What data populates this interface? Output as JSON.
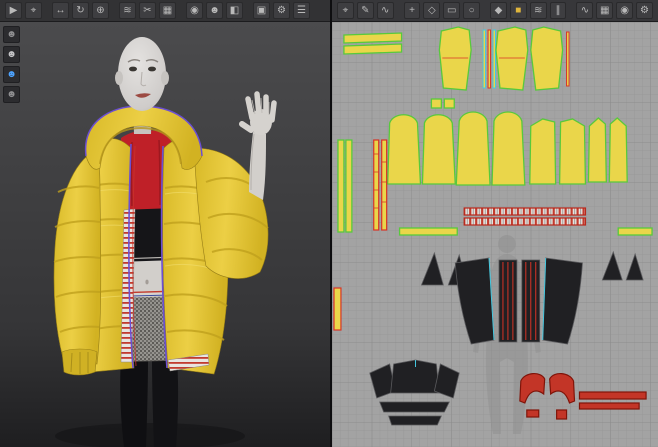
{
  "colors": {
    "toolbar_bg": "#323234",
    "toolbar_icon": "#b9b9b9",
    "accent_blue": "#4da3ff",
    "viewport3d_top": "#4b4b4d",
    "viewport3d_bottom": "#1e1e20",
    "jacket_yellow": "#e8c93a",
    "jacket_seam_shadow": "#bfa01d",
    "trim_purple": "#6b4fd2",
    "trim_red": "#c8352c",
    "crop_top_red": "#bf2028",
    "garment_black": "#151518",
    "skin": "#d2cfcb",
    "skirt_tweed_gray": "#96948f",
    "pattern_bg": "#a3a3a3",
    "grid_minor": "#989898",
    "grid_major": "#8c8c8c",
    "pattern_yellow": "#ead64a",
    "pattern_outline_green": "#58c93c",
    "pattern_black": "#202023",
    "pattern_red": "#c33527",
    "pattern_cyan": "#45c8e0",
    "ghost_silhouette": "#8f8f8f"
  },
  "left_panel": {
    "toolbar_icons": [
      {
        "name": "simulate",
        "glyph": "▶"
      },
      {
        "name": "select-tool",
        "glyph": "⌖"
      },
      {
        "name": "move-tool",
        "glyph": "↔",
        "gap": 1
      },
      {
        "name": "rotate-tool",
        "glyph": "↻"
      },
      {
        "name": "pin-tool",
        "glyph": "⊕"
      },
      {
        "name": "sewing-tool",
        "glyph": "≋",
        "gap": 1
      },
      {
        "name": "scissors-tool",
        "glyph": "✂"
      },
      {
        "name": "texture-view",
        "glyph": "▦"
      },
      {
        "name": "camera-view",
        "glyph": "◉",
        "gap": 1
      },
      {
        "name": "avatar-display",
        "glyph": "☻"
      },
      {
        "name": "cloth-display",
        "glyph": "◧"
      },
      {
        "name": "mesh-display",
        "glyph": "▣",
        "gap": 1
      },
      {
        "name": "render-settings",
        "glyph": "⚙"
      },
      {
        "name": "view-menu",
        "glyph": "☰"
      }
    ],
    "side_toolbar_icons": [
      {
        "name": "show-avatar",
        "glyph": "☻",
        "color": "#8f8f91"
      },
      {
        "name": "avatar-skin",
        "glyph": "☻",
        "color": "#c4c4c6"
      },
      {
        "name": "avatar-pose",
        "glyph": "☻",
        "color": "#4da3ff"
      },
      {
        "name": "avatar-arrangement",
        "glyph": "☻",
        "color": "#8f8f91"
      }
    ],
    "scene": {
      "avatar": "female-mannequin",
      "garments": [
        "yellow-puffer-jacket",
        "red-crop-top",
        "black-crop-top",
        "tweed-mini-skirt",
        "black-leggings"
      ]
    }
  },
  "right_panel": {
    "toolbar_icons": [
      {
        "name": "transform-pattern",
        "glyph": "⌖"
      },
      {
        "name": "edit-pattern",
        "glyph": "✎"
      },
      {
        "name": "edit-curvature",
        "glyph": "∿"
      },
      {
        "name": "add-point",
        "glyph": "+",
        "gap": 1
      },
      {
        "name": "polygon-tool",
        "glyph": "◇"
      },
      {
        "name": "rectangle-tool",
        "glyph": "▭"
      },
      {
        "name": "circle-tool",
        "glyph": "○"
      },
      {
        "name": "dart-tool",
        "glyph": "◆",
        "gap": 1
      },
      {
        "name": "grading-tool",
        "glyph": "■",
        "color": "#e0b63c"
      },
      {
        "name": "edit-sewing",
        "glyph": "≋"
      },
      {
        "name": "segment-sewing",
        "glyph": "∥"
      },
      {
        "name": "free-sewing",
        "glyph": "∿",
        "gap": 1
      },
      {
        "name": "texture-edit",
        "glyph": "▦"
      },
      {
        "name": "pattern-info",
        "glyph": "◉"
      },
      {
        "name": "pattern-options",
        "glyph": "⚙"
      }
    ],
    "pattern_groups": [
      "jacket-panels-yellow",
      "zipper-trim-strips",
      "rib-stripe-trims",
      "lining-panels-black",
      "crop-top-black",
      "red-under-layer"
    ]
  }
}
